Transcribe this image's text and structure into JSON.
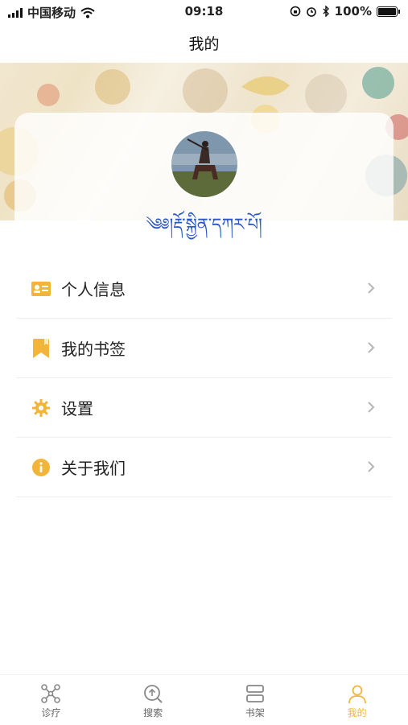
{
  "status_bar": {
    "carrier": "中国移动",
    "time": "09:18",
    "battery": "100%"
  },
  "nav": {
    "title": "我的"
  },
  "profile": {
    "username": "༄༅།རྡོ་སྐྱིན་དཀར་པོ།"
  },
  "menu": [
    {
      "label": "个人信息",
      "icon": "id-card-icon"
    },
    {
      "label": "我的书签",
      "icon": "bookmark-icon"
    },
    {
      "label": "设置",
      "icon": "gear-icon"
    },
    {
      "label": "关于我们",
      "icon": "info-icon"
    }
  ],
  "tabbar": [
    {
      "label": "诊疗",
      "icon": "network-icon",
      "active": false
    },
    {
      "label": "搜索",
      "icon": "search-icon",
      "active": false
    },
    {
      "label": "书架",
      "icon": "bookshelf-icon",
      "active": false
    },
    {
      "label": "我的",
      "icon": "person-icon",
      "active": true
    }
  ],
  "colors": {
    "accent": "#f1b53c",
    "username": "#2a57c8"
  }
}
